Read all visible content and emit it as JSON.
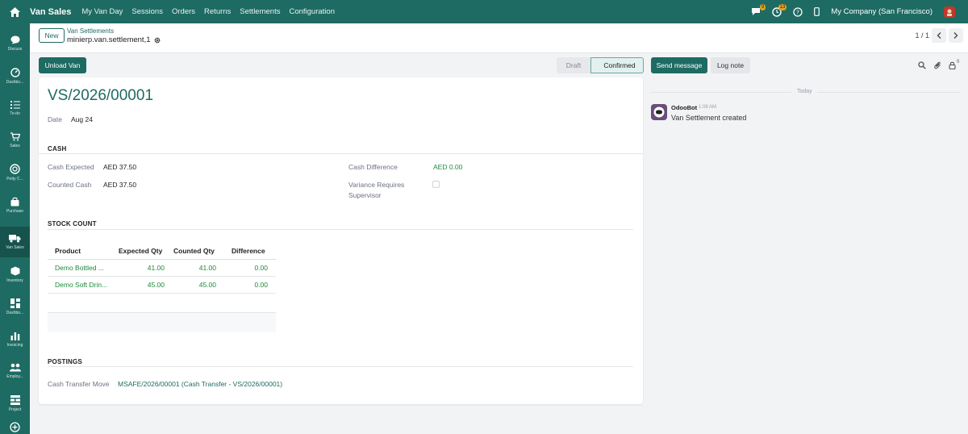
{
  "navbar": {
    "brand": "Van Sales",
    "menu": [
      "My Van Day",
      "Sessions",
      "Orders",
      "Returns",
      "Settlements",
      "Configuration"
    ],
    "messages_badge": "9",
    "activity_badge": "13",
    "company": "My Company (San Francisco)"
  },
  "sidebar": {
    "items": [
      {
        "label": "Discuss",
        "icon": "chat-icon"
      },
      {
        "label": "Dashbo...",
        "icon": "dashboard-gauge-icon"
      },
      {
        "label": "To-do",
        "icon": "checklist-icon"
      },
      {
        "label": "Sales",
        "icon": "cart-icon"
      },
      {
        "label": "Petty C...",
        "icon": "coin-icon"
      },
      {
        "label": "Purchase",
        "icon": "bag-icon"
      },
      {
        "label": "Van Sales",
        "icon": "truck-icon"
      },
      {
        "label": "Inventory",
        "icon": "box-icon"
      },
      {
        "label": "Dashbo...",
        "icon": "grid-icon"
      },
      {
        "label": "Invoicing",
        "icon": "bar-chart-icon"
      },
      {
        "label": "Employ...",
        "icon": "people-icon"
      },
      {
        "label": "Project",
        "icon": "project-icon"
      }
    ]
  },
  "control": {
    "new_label": "New",
    "breadcrumb_parent": "Van Settlements",
    "breadcrumb_current": "minierp.van.settlement,1",
    "pager": "1 / 1"
  },
  "actions": {
    "unload_van": "Unload Van",
    "send_message": "Send message",
    "log_note": "Log note"
  },
  "status": {
    "stages": [
      "Draft",
      "Confirmed"
    ],
    "current": "Confirmed"
  },
  "form": {
    "title": "VS/2026/00001",
    "date_label": "Date",
    "date_value": "Aug 24",
    "cash": {
      "section": "CASH",
      "expected_label": "Cash Expected",
      "expected_value": "AED 37.50",
      "counted_label": "Counted Cash",
      "counted_value": "AED 37.50",
      "difference_label": "Cash Difference",
      "difference_value": "AED 0.00",
      "variance_label_line1": "Variance Requires",
      "variance_label_line2": "Supervisor",
      "variance_checked": false
    },
    "stock": {
      "section": "STOCK COUNT",
      "columns": [
        "Product",
        "Expected Qty",
        "Counted Qty",
        "Difference"
      ],
      "rows": [
        {
          "product": "Demo Bottled ...",
          "expected": "41.00",
          "counted": "41.00",
          "difference": "0.00"
        },
        {
          "product": "Demo Soft Drin...",
          "expected": "45.00",
          "counted": "45.00",
          "difference": "0.00"
        }
      ]
    },
    "postings": {
      "section": "POSTINGS",
      "move_label": "Cash Transfer Move",
      "move_value": "MSAFE/2026/00001 (Cash Transfer - VS/2026/00001)"
    }
  },
  "chatter": {
    "followers_count": "0",
    "today_label": "Today",
    "messages": [
      {
        "author": "OdooBot",
        "time": "1:08 AM",
        "body": "Van Settlement created"
      }
    ]
  },
  "colors": {
    "brand": "#1e6b63",
    "link_green": "#1e8a3a",
    "background": "#f2f3f5"
  }
}
